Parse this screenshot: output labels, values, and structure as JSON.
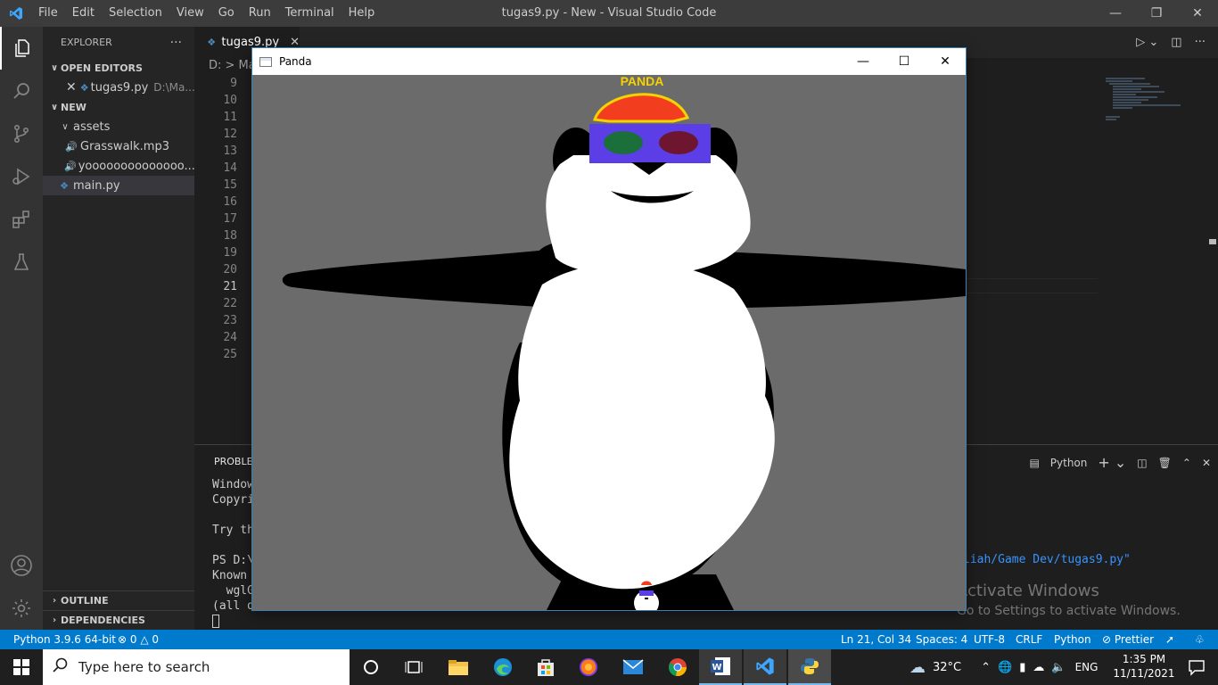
{
  "window_title": "tugas9.py - New - Visual Studio Code",
  "menu": [
    "File",
    "Edit",
    "Selection",
    "View",
    "Go",
    "Run",
    "Terminal",
    "Help"
  ],
  "sidebar": {
    "header": "EXPLORER",
    "open_editors_label": "OPEN EDITORS",
    "open_editor": {
      "name": "tugas9.py",
      "path": "D:\\Ma..."
    },
    "folder_label": "NEW",
    "assets_label": "assets",
    "files": [
      "Grasswalk.mp3",
      "yoooooooooooooo..."
    ],
    "main_file": "main.py",
    "outline_label": "OUTLINE",
    "dependencies_label": "DEPENDENCIES"
  },
  "editor": {
    "tab_label": "tugas9.py",
    "breadcrumb": "D: > Ma",
    "line_numbers": [
      "9",
      "10",
      "11",
      "12",
      "13",
      "14",
      "15",
      "16",
      "17",
      "18",
      "19",
      "20",
      "21",
      "22",
      "23",
      "24",
      "25"
    ],
    "current_line": "21"
  },
  "panel": {
    "tab_label": "PROBLEN",
    "terminal_name": "Python",
    "terminal_lines": [
      "Windows",
      "Copyrig",
      "",
      "Try the",
      "",
      "PS D:\\",
      "Known p",
      "  wglGr",
      "(all di"
    ],
    "terminal_path": "liah/Game Dev/tugas9.py\""
  },
  "watermark": {
    "title": "Activate Windows",
    "subtitle": "Go to Settings to activate Windows."
  },
  "statusbar": {
    "python_version": "Python 3.9.6 64-bit",
    "errors": "0",
    "warnings": "0",
    "position": "Ln 21, Col 34",
    "spaces": "Spaces: 4",
    "encoding": "UTF-8",
    "eol": "CRLF",
    "language": "Python",
    "formatter": "Prettier"
  },
  "panda_window": {
    "title": "Panda",
    "hat_text": "PANDA"
  },
  "taskbar": {
    "search_placeholder": "Type here to search",
    "weather": "32°C",
    "language": "ENG",
    "time": "1:35 PM",
    "date": "11/11/2021"
  },
  "colors": {
    "vscode_blue": "#007acc",
    "panda_bg": "#6b6b6b",
    "hat_red": "#f23d1e",
    "glasses_purple": "#5b3ee6"
  }
}
